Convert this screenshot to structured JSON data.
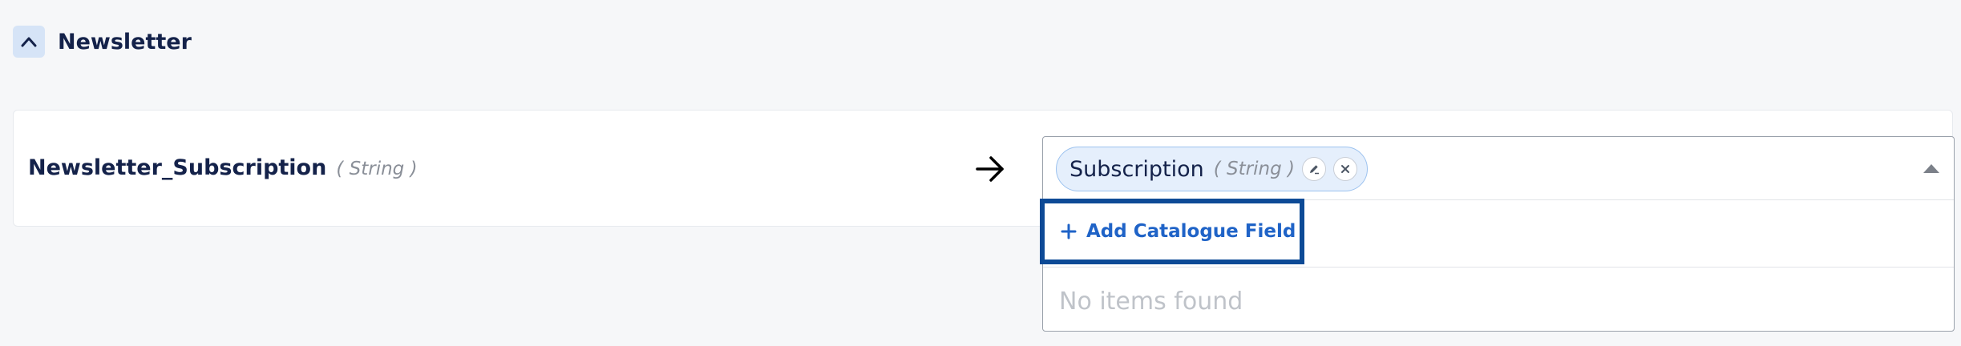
{
  "section": {
    "title": "Newsletter",
    "collapse_icon": "chevron-up-icon"
  },
  "mapping": {
    "source_name": "Newsletter_Subscription",
    "source_type": "( String )",
    "arrow_icon": "arrow-right-icon"
  },
  "target": {
    "chip_label": "Subscription",
    "chip_type": "( String )",
    "chip_icons": [
      "edit-icon",
      "close-icon"
    ],
    "add_field_label": "Add Catalogue Field",
    "add_field_icon": "plus-icon",
    "empty_message": "No items found"
  },
  "colors": {
    "background": "#f6f7f9",
    "primary_text": "#14224a",
    "accent": "#1f63c7",
    "focus_border": "#0d4a96",
    "chip_background": "#e5effc"
  }
}
